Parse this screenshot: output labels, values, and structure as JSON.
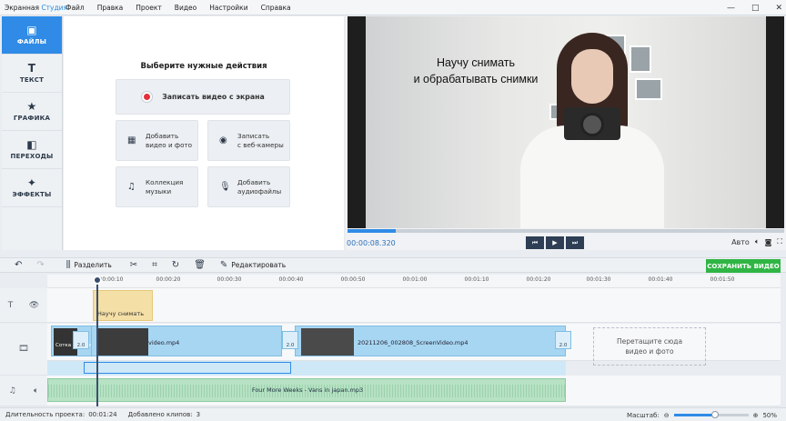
{
  "app": {
    "title_part1": "Экранная ",
    "title_part2": "Студия",
    "menu": [
      "Файл",
      "Правка",
      "Проект",
      "Видео",
      "Настройки",
      "Справка"
    ],
    "window_controls": [
      "—",
      "□",
      "✕"
    ]
  },
  "sidebar": {
    "items": [
      {
        "label": "ФАЙЛЫ",
        "icon": "files-icon",
        "glyph": "▣",
        "active": true
      },
      {
        "label": "ТЕКСТ",
        "icon": "text-icon",
        "glyph": "T",
        "active": false
      },
      {
        "label": "ГРАФИКА",
        "icon": "star-icon",
        "glyph": "★",
        "active": false
      },
      {
        "label": "ПЕРЕХОДЫ",
        "icon": "transitions-icon",
        "glyph": "◧",
        "active": false
      },
      {
        "label": "ЭФФЕКТЫ",
        "icon": "magic-wand-icon",
        "glyph": "✦",
        "active": false
      }
    ]
  },
  "actions": {
    "title": "Выберите нужные действия",
    "record_screen": "Записать видео с экрана",
    "add_video": "Добавить\nвидео и фото",
    "record_webcam": "Записать\nс веб-камеры",
    "music_collection": "Коллекция\nмузыки",
    "add_audio": "Добавить\nаудиофайлы"
  },
  "preview": {
    "caption": "Научу снимать\nи обрабатывать снимки",
    "timecode": "00:00:08.320",
    "progress": 0.11,
    "auto_label": "Авто"
  },
  "toolbar": {
    "split_label": "Разделить",
    "edit_label": "Редактировать",
    "save_label": "СОХРАНИТЬ ВИДЕО"
  },
  "ruler": {
    "ticks": [
      "00:00:10",
      "00:00:20",
      "00:00:30",
      "00:00:40",
      "00:00:50",
      "00:01:00",
      "00:01:10",
      "00:01:20",
      "00:01:30",
      "00:01:40",
      "00:01:50"
    ]
  },
  "timeline": {
    "text_clip_label": "Научу снимать",
    "clip_title_text": "Сотка графика",
    "clip1_name": "video.mp4",
    "clip2_name": "20211206_002808_ScreenVideo.mp4",
    "transition_duration": "2.0",
    "drop_zone": "Перетащите сюда\nвидео и фото",
    "audio_name": "Four More Weeks - Vans in japan.mp3"
  },
  "status": {
    "duration_label": "Длительность проекта:",
    "duration_value": "00:01:24",
    "clips_label": "Добавлено клипов:",
    "clips_value": "3",
    "zoom_label": "Масштаб:",
    "zoom_value": "50%"
  },
  "colors": {
    "accent": "#2f8be6",
    "save": "#2fb544",
    "video_track": "#a7d6f2",
    "audio_track": "#b7e2c4",
    "text_track": "#f4dfa6"
  }
}
